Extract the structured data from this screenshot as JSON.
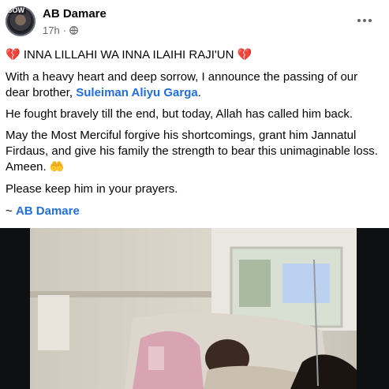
{
  "header": {
    "author": "AB Damare",
    "time": "17h",
    "avatar_badge": "BOW",
    "icons": [
      "globe-icon",
      "more-options-icon"
    ]
  },
  "post": {
    "title_text": "INNA LILLAHI WA INNA ILAIHI RAJI'UN",
    "heart_glyph": "💔",
    "p1_before": "With a heavy heart and deep sorrow, I announce the passing of our dear brother, ",
    "p1_link": "Suleiman Aliyu Garga",
    "p1_after": ".",
    "p2": "He fought bravely till the end, but today, Allah has called him back.",
    "p3": "May the Most Merciful forgive his shortcomings, grant him Jannatul Firdaus, and give his family the strength to bear this unimaginable loss. Ameen.",
    "p3_emoji": "🤲",
    "p4": "Please keep him in your prayers.",
    "signoff_prefix": "~ ",
    "signoff_link": "AB Damare"
  },
  "colors": {
    "link": "#216fdb",
    "meta": "#65676b",
    "text": "#050505"
  }
}
